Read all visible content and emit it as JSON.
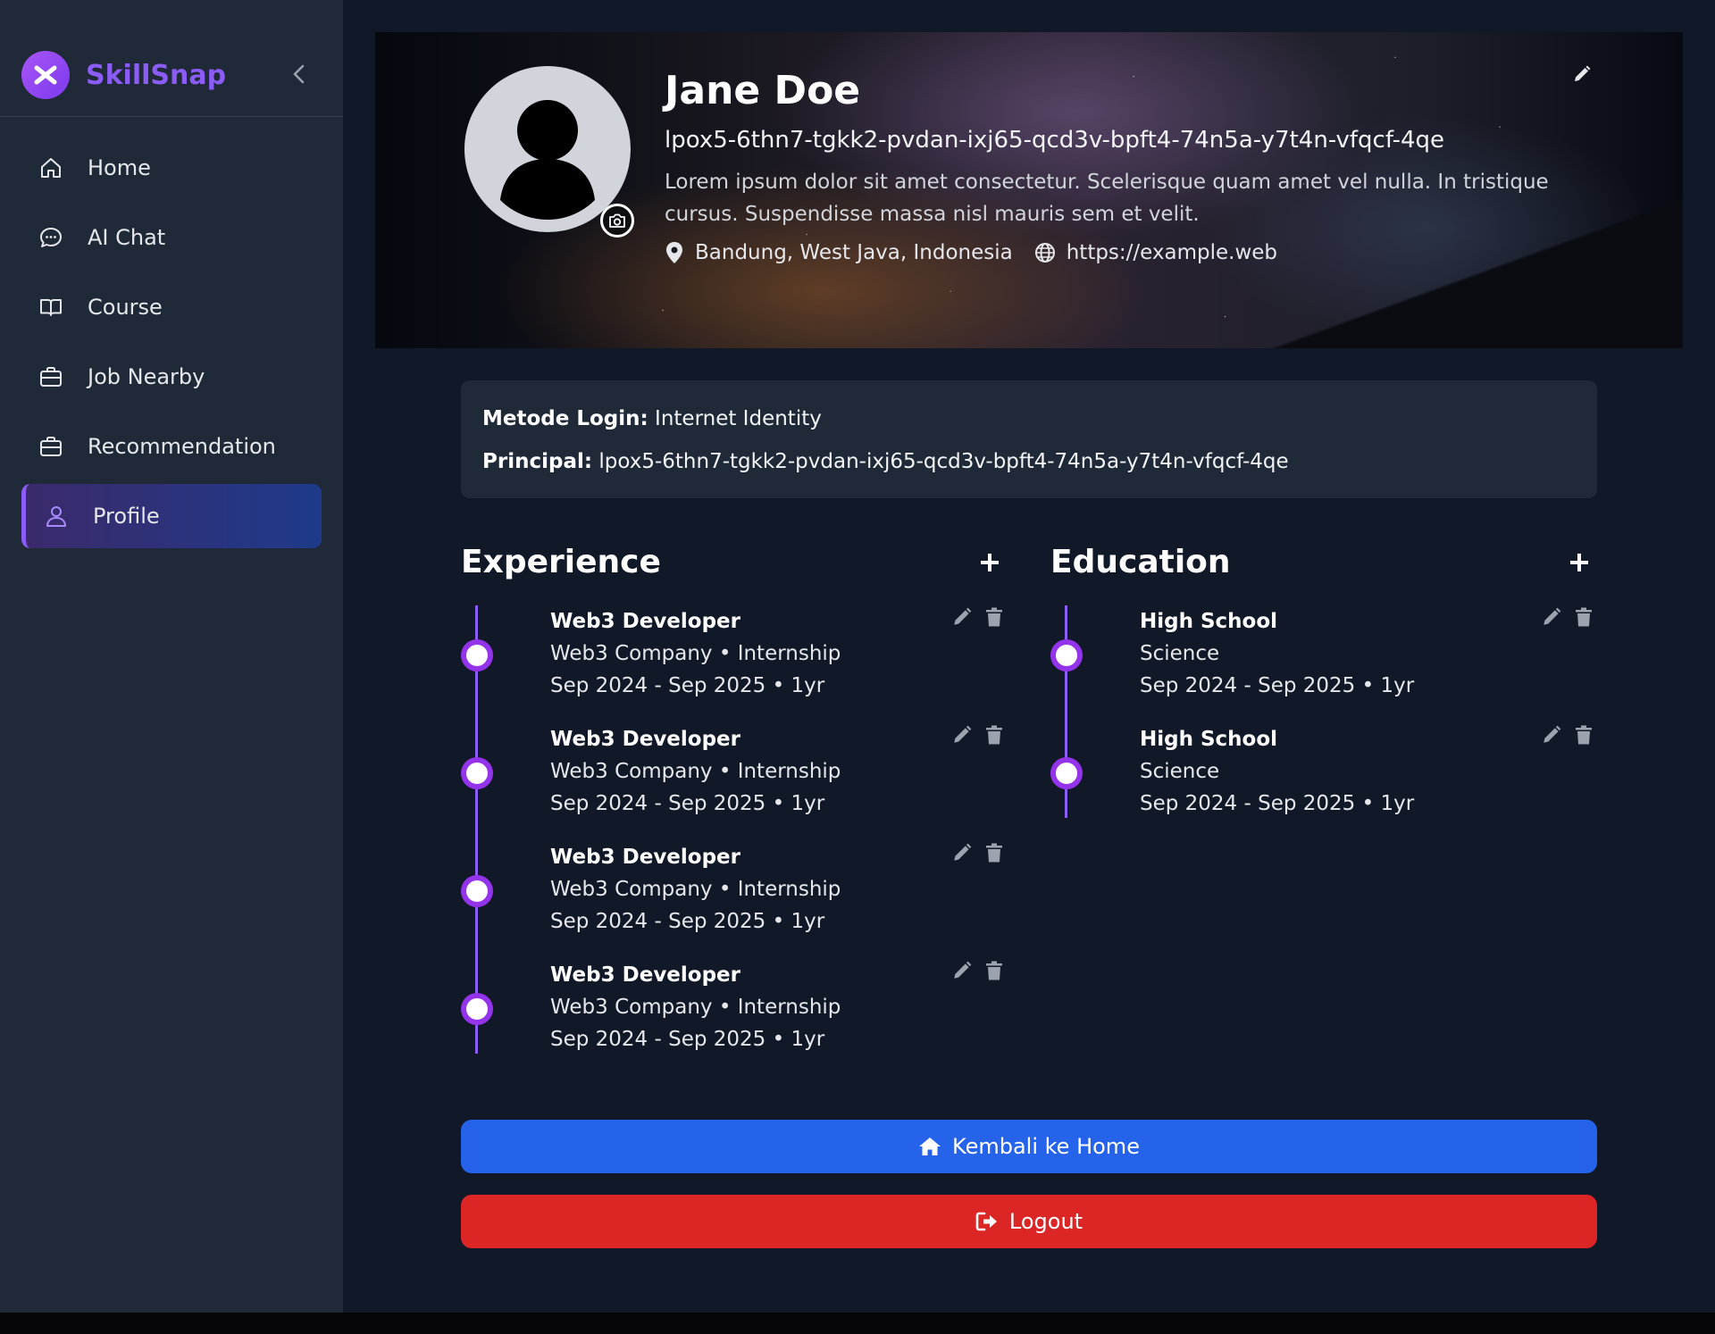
{
  "app": {
    "name": "SkillSnap"
  },
  "colors": {
    "accent": "#8b5cf6",
    "primary_button": "#2563eb",
    "danger_button": "#dc2626",
    "sidebar_bg": "#1f2937",
    "page_bg": "#111827"
  },
  "sidebar": {
    "items": [
      {
        "label": "Home",
        "icon": "home-icon",
        "active": false
      },
      {
        "label": "AI Chat",
        "icon": "chat-bubble-icon",
        "active": false
      },
      {
        "label": "Course",
        "icon": "book-icon",
        "active": false
      },
      {
        "label": "Job Nearby",
        "icon": "briefcase-icon",
        "active": false
      },
      {
        "label": "Recommendation",
        "icon": "briefcase-icon",
        "active": false
      },
      {
        "label": "Profile",
        "icon": "user-icon",
        "active": true
      }
    ]
  },
  "profile": {
    "name": "Jane Doe",
    "principal": "lpox5-6thn7-tgkk2-pvdan-ixj65-qcd3v-bpft4-74n5a-y7t4n-vfqcf-4qe",
    "bio": "Lorem ipsum dolor sit amet consectetur. Scelerisque quam amet vel nulla. In tristique cursus. Suspendisse massa nisl mauris sem et velit.",
    "location": "Bandung, West Java, Indonesia",
    "website": "https://example.web"
  },
  "login_info": {
    "method_label": "Metode Login:",
    "method_value": "Internet Identity",
    "principal_label": "Principal:",
    "principal_value": "lpox5-6thn7-tgkk2-pvdan-ixj65-qcd3v-bpft4-74n5a-y7t4n-vfqcf-4qe"
  },
  "experience": {
    "title": "Experience",
    "items": [
      {
        "title": "Web3 Developer",
        "subtitle": "Web3 Company • Internship",
        "dates": "Sep 2024 - Sep 2025 • 1yr"
      },
      {
        "title": "Web3 Developer",
        "subtitle": "Web3 Company • Internship",
        "dates": "Sep 2024 - Sep 2025 • 1yr"
      },
      {
        "title": "Web3 Developer",
        "subtitle": "Web3 Company • Internship",
        "dates": "Sep 2024 - Sep 2025 • 1yr"
      },
      {
        "title": "Web3 Developer",
        "subtitle": "Web3 Company • Internship",
        "dates": "Sep 2024 - Sep 2025 • 1yr"
      }
    ]
  },
  "education": {
    "title": "Education",
    "items": [
      {
        "title": "High School",
        "subtitle": "Science",
        "dates": "Sep 2024 - Sep 2025 • 1yr"
      },
      {
        "title": "High School",
        "subtitle": "Science",
        "dates": "Sep 2024 - Sep 2025 • 1yr"
      }
    ]
  },
  "actions": {
    "home_label": "Kembali ke Home",
    "logout_label": "Logout"
  }
}
